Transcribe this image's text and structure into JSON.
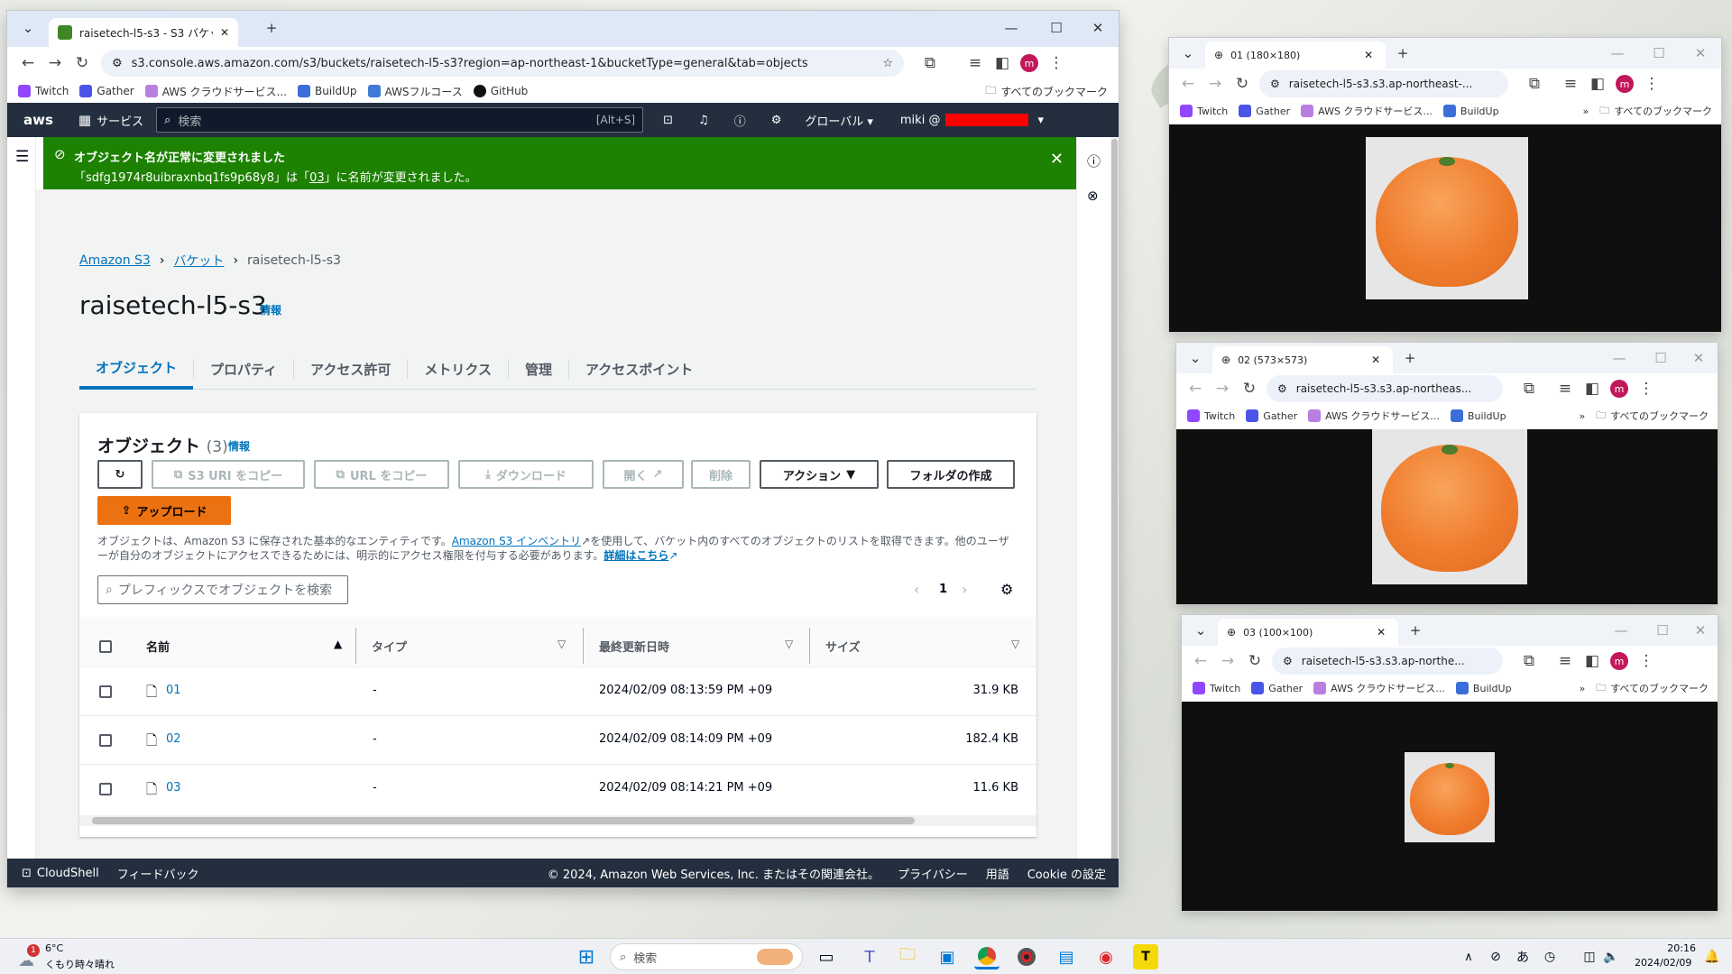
{
  "main_browser": {
    "tab_title": "raisetech-l5-s3 - S3 バケット | S3",
    "url": "s3.console.aws.amazon.com/s3/buckets/raisetech-l5-s3?region=ap-northeast-1&bucketType=general&tab=objects",
    "bookmarks": [
      "Twitch",
      "Gather",
      "AWS クラウドサービス...",
      "BuildUp",
      "AWSフルコース",
      "GitHub"
    ],
    "all_bookmarks": "すべてのブックマーク",
    "avatar_letter": "m"
  },
  "aws_nav": {
    "logo": "aws",
    "services": "サービス",
    "search_placeholder": "検索",
    "shortcut": "[Alt+S]",
    "region": "グローバル ▾",
    "user": "miki @"
  },
  "flash": {
    "title": "オブジェクト名が正常に変更されました",
    "message_prefix": "「sdfg1974r8uibraxnbq1fs9p68y8」は「",
    "message_new_name": "03",
    "message_suffix": "」に名前が変更されました。"
  },
  "breadcrumb": [
    "Amazon S3",
    "バケット",
    "raisetech-l5-s3"
  ],
  "page_title": "raisetech-l5-s3",
  "info": "情報",
  "tabs": [
    "オブジェクト",
    "プロパティ",
    "アクセス許可",
    "メトリクス",
    "管理",
    "アクセスポイント"
  ],
  "objects": {
    "heading": "オブジェクト",
    "count": "(3)",
    "buttons": {
      "copy_s3_uri": "S3 URI をコピー",
      "copy_url": "URL をコピー",
      "download": "ダウンロード",
      "open": "開く",
      "delete": "削除",
      "actions": "アクション",
      "create_folder": "フォルダの作成",
      "upload": "アップロード"
    },
    "description_1": "オブジェクトは、Amazon S3 に保存された基本的なエンティティです。",
    "inventory_link": "Amazon S3 インベントリ",
    "description_2": "を使用して、バケット内のすべてのオブジェクトのリストを取得できます。他のユーザーが自分のオブジェクトにアクセスできるためには、明示的にアクセス権限を付与する必要があります。",
    "learn_more": "詳細はこちら",
    "search_placeholder": "プレフィックスでオブジェクトを検索",
    "page": "1",
    "columns": [
      "名前",
      "タイプ",
      "最終更新日時",
      "サイズ"
    ],
    "rows": [
      {
        "name": "01",
        "type": "-",
        "modified": "2024/02/09 08:13:59 PM +09",
        "size": "31.9 KB"
      },
      {
        "name": "02",
        "type": "-",
        "modified": "2024/02/09 08:14:09 PM +09",
        "size": "182.4 KB"
      },
      {
        "name": "03",
        "type": "-",
        "modified": "2024/02/09 08:14:21 PM +09",
        "size": "11.6 KB"
      }
    ]
  },
  "footer": {
    "cloudshell": "CloudShell",
    "feedback": "フィードバック",
    "copyright": "© 2024, Amazon Web Services, Inc. またはその関連会社。",
    "privacy": "プライバシー",
    "terms": "用語",
    "cookie": "Cookie の設定"
  },
  "small_windows": [
    {
      "tab_title": "01 (180×180)",
      "url": "raisetech-l5-s3.s3.ap-northeast-..."
    },
    {
      "tab_title": "02 (573×573)",
      "url": "raisetech-l5-s3.s3.ap-northeas..."
    },
    {
      "tab_title": "03 (100×100)",
      "url": "raisetech-l5-s3.s3.ap-northe..."
    }
  ],
  "small_bookmarks": [
    "Twitch",
    "Gather",
    "AWS クラウドサービス...",
    "BuildUp"
  ],
  "taskbar": {
    "temp": "6°C",
    "weather": "くもり時々晴れ",
    "search": "検索",
    "time": "20:16",
    "date": "2024/02/09",
    "ime": "あ",
    "badge": "1"
  },
  "colors": {
    "aws_dark": "#232f3e",
    "success": "#1d8102",
    "upload": "#ec7211",
    "link": "#0073bb"
  }
}
